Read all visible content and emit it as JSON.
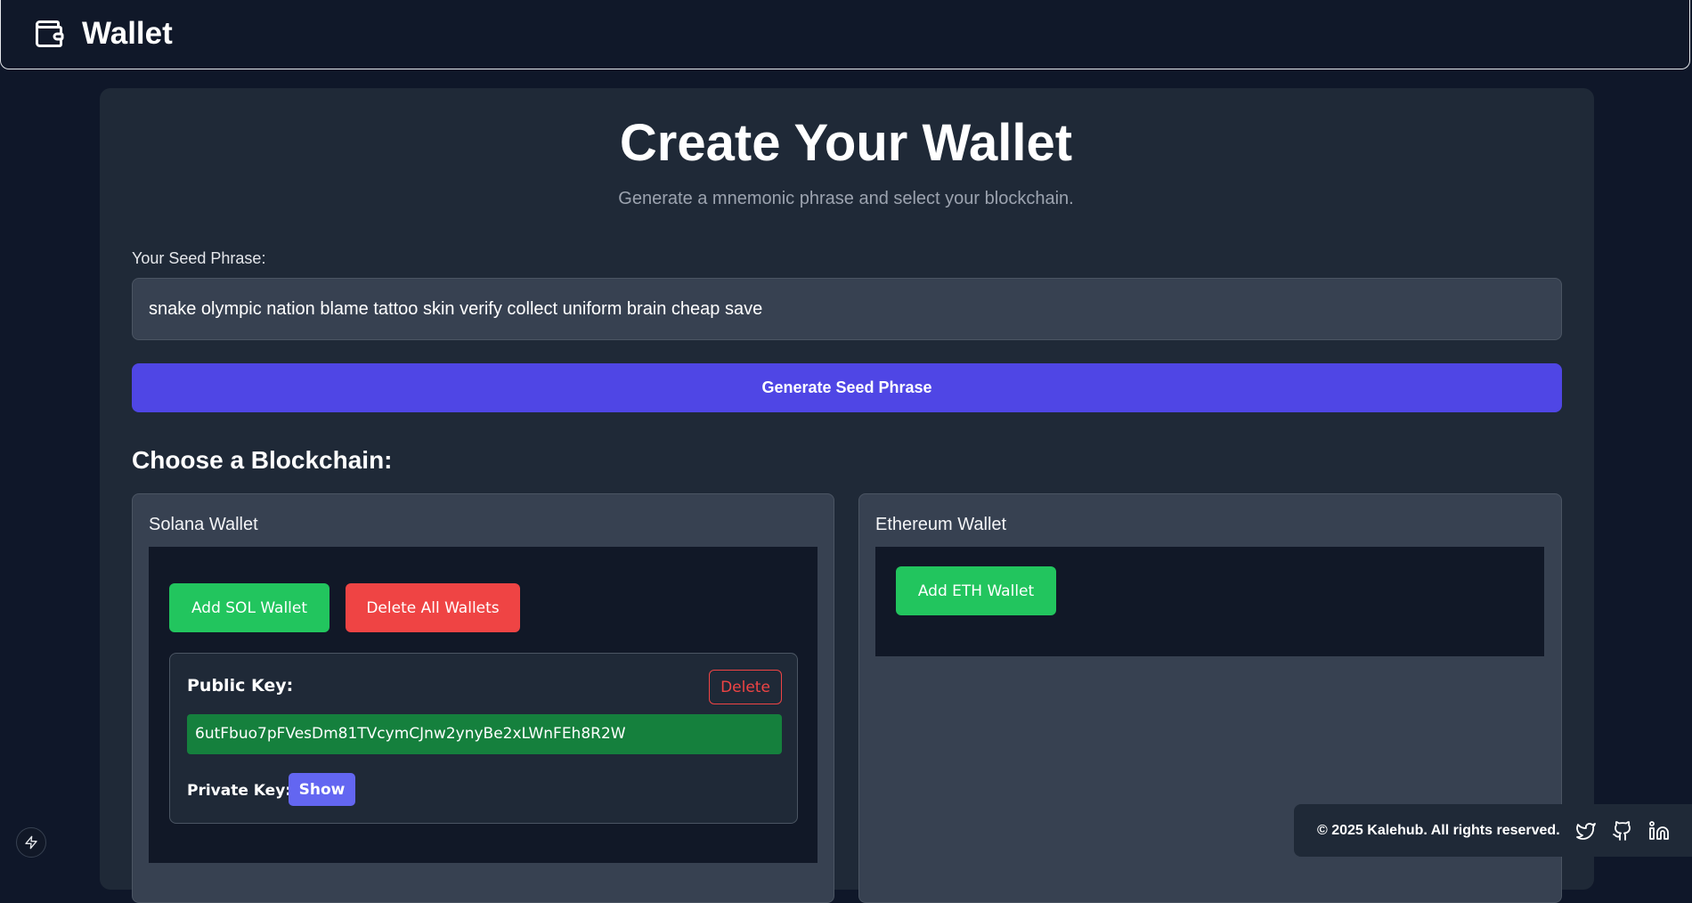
{
  "header": {
    "title": "Wallet",
    "logo_icon": "wallet-icon"
  },
  "main": {
    "title": "Create Your Wallet",
    "subtitle": "Generate a mnemonic phrase and select your blockchain.",
    "seed_label": "Your Seed Phrase:",
    "seed_phrase": "snake olympic nation blame tattoo skin verify collect uniform brain cheap save",
    "generate_button": "Generate Seed Phrase",
    "choose_title": "Choose a Blockchain:"
  },
  "solana": {
    "title": "Solana Wallet",
    "add_button": "Add SOL Wallet",
    "delete_all_button": "Delete All Wallets",
    "wallets": [
      {
        "public_key_label": "Public Key:",
        "public_key": "6utFbuo7pFVesDm81TVcymCJnw2ynyBe2xLWnFEh8R2W",
        "delete_label": "Delete",
        "private_key_label": "Private Key:",
        "show_label": "Show"
      }
    ]
  },
  "ethereum": {
    "title": "Ethereum Wallet",
    "add_button": "Add ETH Wallet"
  },
  "footer": {
    "copyright": "© 2025 Kalehub. All rights reserved.",
    "icons": [
      "twitter-icon",
      "github-icon",
      "linkedin-icon"
    ]
  },
  "colors": {
    "background": "#0f1729",
    "card": "#1f2937",
    "primary": "#4f46e5",
    "success": "#22c55e",
    "danger": "#ef4444",
    "key_bg": "#15803d"
  }
}
